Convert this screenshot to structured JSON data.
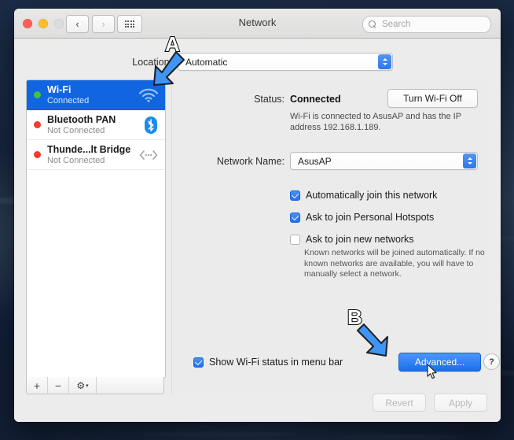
{
  "window": {
    "title": "Network",
    "traffic_lights": [
      "close",
      "minimize",
      "zoom"
    ],
    "nav": {
      "back": "back-chevron",
      "forward": "forward-chevron",
      "show_all": "grid-icon"
    },
    "search": {
      "placeholder": "Search",
      "value": ""
    }
  },
  "location": {
    "label": "Location:",
    "value": "Automatic"
  },
  "sidebar": {
    "services": [
      {
        "name": "Wi-Fi",
        "status": "Connected",
        "dot": "green",
        "icon": "wifi-icon",
        "selected": true
      },
      {
        "name": "Bluetooth PAN",
        "status": "Not Connected",
        "dot": "red",
        "icon": "bluetooth-icon",
        "selected": false
      },
      {
        "name": "Thunde...lt Bridge",
        "status": "Not Connected",
        "dot": "red",
        "icon": "thunderbolt-bridge-icon",
        "selected": false
      }
    ],
    "toolbar": {
      "add": "+",
      "remove": "−",
      "actions": "⚙",
      "actions_chevron": "▾"
    }
  },
  "panel": {
    "status_label": "Status:",
    "status_value": "Connected",
    "wifi_toggle_label": "Turn Wi-Fi Off",
    "status_description": "Wi-Fi is connected to AsusAP and has the IP address 192.168.1.189.",
    "network_name_label": "Network Name:",
    "network_name_value": "AsusAP",
    "checkboxes": [
      {
        "label": "Automatically join this network",
        "checked": true
      },
      {
        "label": "Ask to join Personal Hotspots",
        "checked": true
      },
      {
        "label": "Ask to join new networks",
        "checked": false
      }
    ],
    "help_text": "Known networks will be joined automatically. If no known networks are available, you will have to manually select a network.",
    "show_status_checkbox": {
      "label": "Show Wi-Fi status in menu bar",
      "checked": true
    },
    "advanced_label": "Advanced...",
    "help_button_label": "?"
  },
  "footer": {
    "revert_label": "Revert",
    "apply_label": "Apply",
    "revert_enabled": false,
    "apply_enabled": false
  },
  "annotations": [
    {
      "letter": "A",
      "target": "location-popup",
      "direction": "down-left",
      "color": "#3e95f6"
    },
    {
      "letter": "B",
      "target": "advanced-button",
      "direction": "down-right",
      "color": "#3e95f6"
    }
  ]
}
